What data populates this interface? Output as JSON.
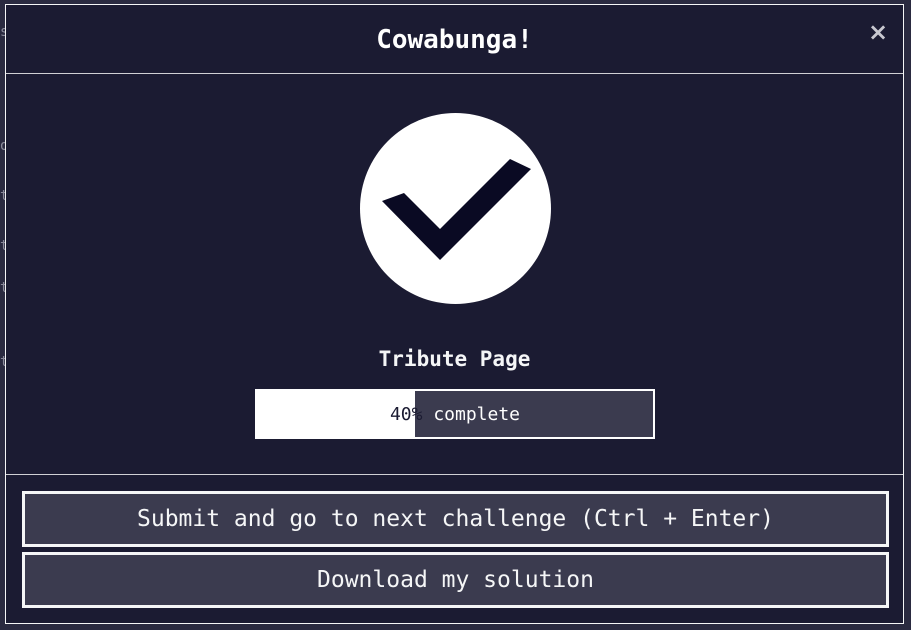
{
  "modal": {
    "title": "Cowabunga!",
    "close_glyph": "×",
    "success_icon": "check-circle-icon",
    "challenge_title": "Tribute Page",
    "progress": {
      "percent": 40,
      "percent_label": "40%",
      "suffix": " complete"
    },
    "buttons": {
      "submit_label": "Submit and go to next challenge (Ctrl + Enter)",
      "download_label": "Download my solution"
    }
  },
  "colors": {
    "modal_bg": "#1b1b32",
    "button_bg": "#3b3b4f",
    "border": "#f5f6f7",
    "check_mark": "#0a0a23"
  }
}
